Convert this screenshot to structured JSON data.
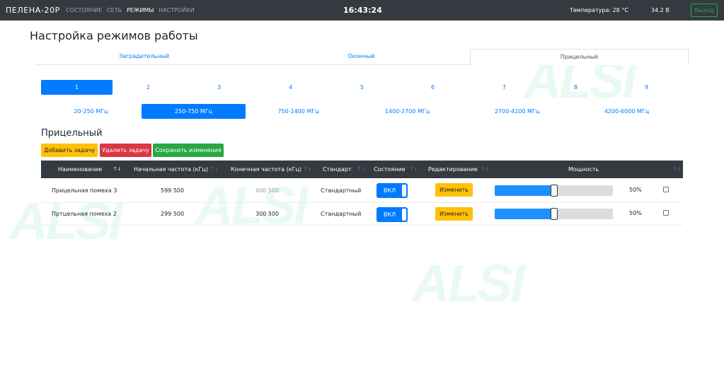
{
  "navbar": {
    "brand": "ПЕЛЕНА-20Р",
    "links": [
      "СОСТОЯНИЕ",
      "СЕТЬ",
      "РЕЖИМЫ",
      "НАСТРОЙКИ"
    ],
    "active_link": "РЕЖИМЫ",
    "clock": "16:43:24",
    "temperature": "Температура: 28 °C",
    "voltage": "34.2 В",
    "logout": "Выход"
  },
  "watermark": "ALSI",
  "page_title": "Настройка режимов работы",
  "mode_tabs": [
    "Заградительный",
    "Оконный",
    "Прицельный"
  ],
  "active_mode_tab": "Прицельный",
  "numbers": [
    "1",
    "2",
    "3",
    "4",
    "5",
    "6",
    "7",
    "8",
    "9"
  ],
  "active_number": "1",
  "freq_ranges": [
    "20-250 МГц",
    "250-750 МГц",
    "750-1400 МГц",
    "1400-2700 МГц",
    "2700-4200 МГц",
    "4200-6000 МГц"
  ],
  "active_freq": "250-750 МГц",
  "section_title": "Прицельный",
  "actions": {
    "add": "Добавить задачу",
    "delete": "Удалить задачу",
    "save": "Сохранить изменения"
  },
  "table": {
    "headers": [
      "Наименование",
      "Начальная частота (кГц)",
      "Конечная частота (кГц)",
      "Стандарт",
      "Состояние",
      "Редактирование",
      "Мощность"
    ],
    "rows": [
      {
        "name": "Прицельная помеха 3",
        "start": "599 500",
        "end": "600 500",
        "standard": "Стандартный",
        "state": "ВКЛ",
        "edit": "Изменить",
        "power": 50,
        "power_label": "50%",
        "selected": false
      },
      {
        "name": "Пртцельная помеха 2",
        "start": "299 500",
        "end": "300 500",
        "standard": "Стандартный",
        "state": "ВКЛ",
        "edit": "Изменить",
        "power": 50,
        "power_label": "50%",
        "selected": false
      }
    ]
  },
  "colors": {
    "navbar": "#343a40",
    "primary": "#007bff",
    "warning": "#ffc107",
    "danger": "#dc3545",
    "success": "#28a745",
    "slider_fill": "#1e90ff",
    "watermark": "#2fcf99"
  }
}
